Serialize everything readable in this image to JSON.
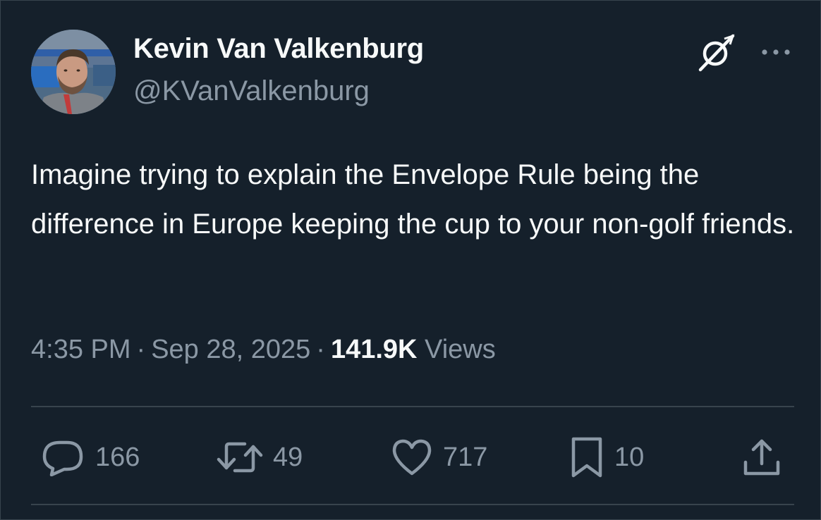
{
  "author": {
    "display_name": "Kevin Van Valkenburg",
    "handle": "@KVanValkenburg"
  },
  "header_icons": {
    "grok": "grok-icon",
    "more": "more-options-icon"
  },
  "tweet": {
    "text": "Imagine trying to explain the Envelope Rule being the difference in Europe keeping the cup to your non-golf friends.",
    "time": "4:35 PM",
    "date": "Sep 28, 2025",
    "separator": "·",
    "views_count": "141.9K",
    "views_label": "Views"
  },
  "actions": {
    "reply_count": "166",
    "repost_count": "49",
    "like_count": "717",
    "bookmark_count": "10"
  },
  "colors": {
    "background": "#15202b",
    "primary_text": "#f7f9f9",
    "secondary_text": "#8b98a5",
    "divider": "#38444d"
  }
}
